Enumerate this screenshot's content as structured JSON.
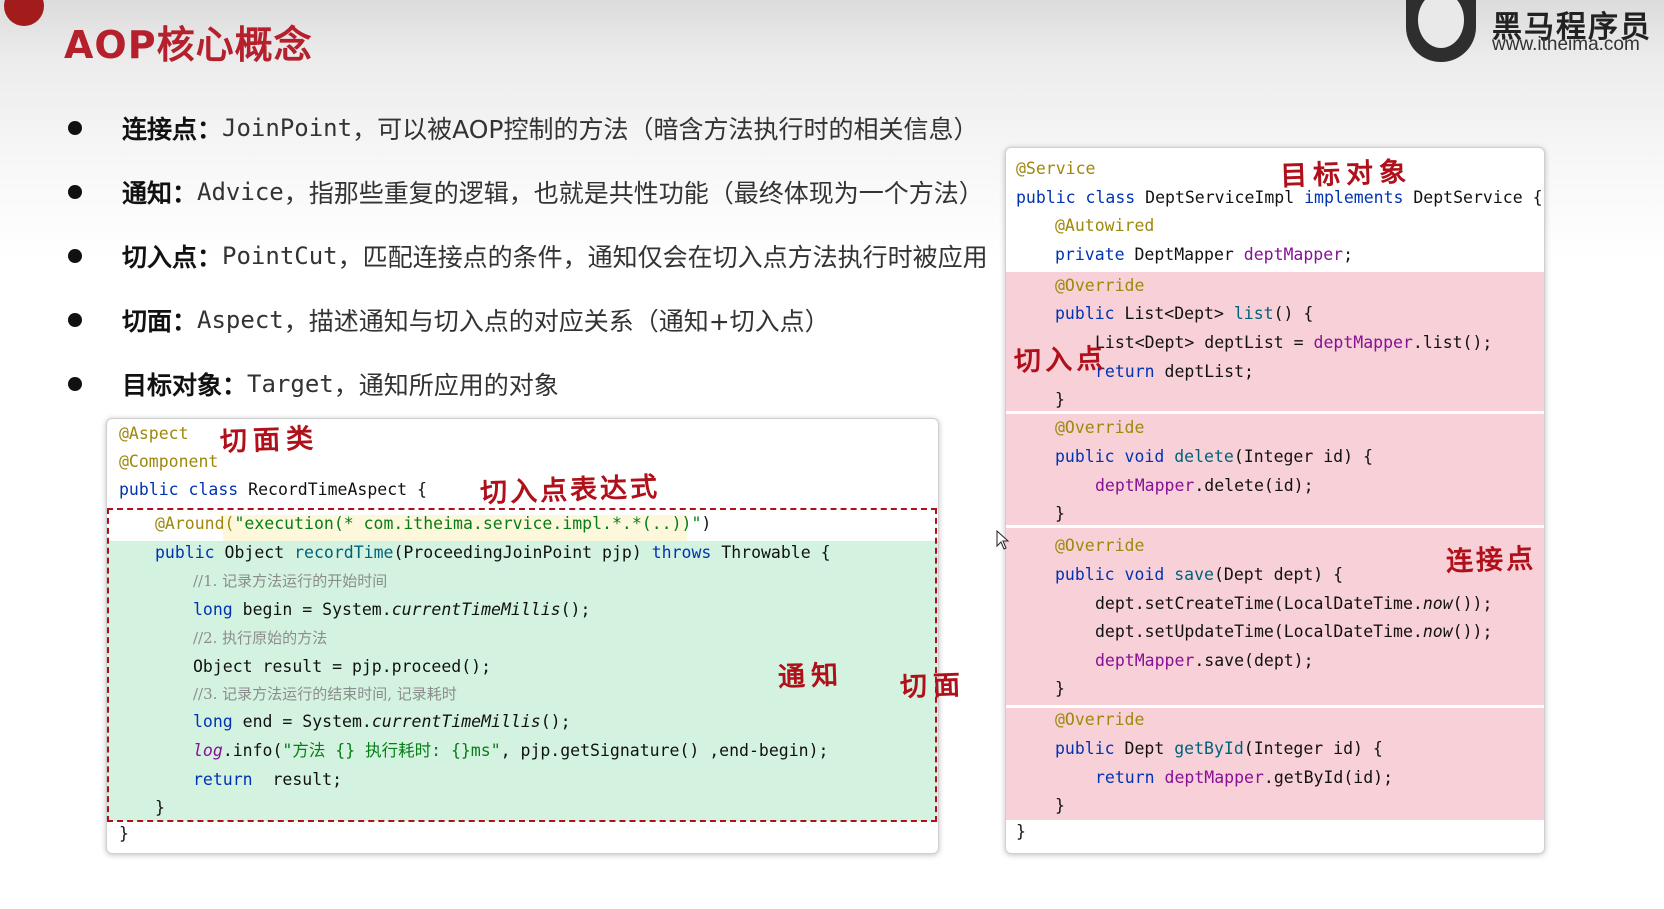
{
  "title": "AOP核心概念",
  "logo": {
    "name": "黑马程序员",
    "url": "www.itheima.com"
  },
  "bullets": [
    {
      "term": "连接点：",
      "en": "JoinPoint",
      "desc": "，可以被AOP控制的方法（暗含方法执行时的相关信息）"
    },
    {
      "term": "通知：",
      "en": "Advice",
      "desc": "，指那些重复的逻辑，也就是共性功能（最终体现为一个方法）"
    },
    {
      "term": "切入点：",
      "en": "PointCut",
      "desc": "，匹配连接点的条件，通知仅会在切入点方法执行时被应用"
    },
    {
      "term": "切面：",
      "en": "Aspect",
      "desc": "，描述通知与切入点的对应关系（通知+切入点）"
    },
    {
      "term": "目标对象：",
      "en": "Target",
      "desc": "，通知所应用的对象"
    }
  ],
  "left_code": {
    "l1": "@Aspect",
    "l2": "@Component",
    "l3_kw": "public class ",
    "l3_rest": "RecordTimeAspect {",
    "l4_ann": "@Around(",
    "l4_str": "\"execution(* com.itheima.service.impl.*.*(..))\"",
    "l4_end": ")",
    "l5_kw": "public ",
    "l5_type": "Object ",
    "l5_fn": "recordTime",
    "l5_args": "(ProceedingJoinPoint pjp) ",
    "l5_kw2": "throws ",
    "l5_end": "Throwable {",
    "l6": "//1. 记录方法运行的开始时间",
    "l7_kw": "long ",
    "l7_a": "begin = System.",
    "l7_it": "currentTimeMillis",
    "l7_b": "();",
    "l8": "//2. 执行原始的方法",
    "l9": "Object result = pjp.proceed();",
    "l10": "//3. 记录方法运行的结束时间, 记录耗时",
    "l11_kw": "long ",
    "l11_a": "end = System.",
    "l11_it": "currentTimeMillis",
    "l11_b": "();",
    "l12_it": "log",
    "l12_a": ".info(",
    "l12_str": "\"方法 {} 执行耗时: {}ms\"",
    "l12_b": ", pjp.getSignature() ,end-begin);",
    "l13_kw": "return ",
    "l13_a": " result;",
    "l14": "}",
    "l15": "}"
  },
  "right_code": {
    "r1": "@Service",
    "r2_kw": "public class ",
    "r2_a": "DeptServiceImpl ",
    "r2_kw2": "implements ",
    "r2_b": "DeptService {",
    "r3": "@Autowired",
    "r4_kw": "private ",
    "r4_a": "DeptMapper ",
    "r4_f": "deptMapper",
    "r4_b": ";",
    "r5": "@Override",
    "r6_kw": "public ",
    "r6_a": "List<Dept> ",
    "r6_fn": "list",
    "r6_b": "() {",
    "r7_a": "List<Dept> deptList = ",
    "r7_f": "deptMapper",
    "r7_b": ".list();",
    "r8_kw": "return ",
    "r8_a": "deptList;",
    "r9": "}",
    "r10": "@Override",
    "r11_kw": "public void ",
    "r11_fn": "delete",
    "r11_b": "(Integer id) {",
    "r12_f": "deptMapper",
    "r12_b": ".delete(id);",
    "r13": "}",
    "r14": "@Override",
    "r15_kw": "public void ",
    "r15_fn": "save",
    "r15_b": "(Dept dept) {",
    "r16_a": "dept.setCreateTime(LocalDateTime.",
    "r16_it": "now",
    "r16_b": "());",
    "r17_a": "dept.setUpdateTime(LocalDateTime.",
    "r17_it": "now",
    "r17_b": "());",
    "r18_f": "deptMapper",
    "r18_b": ".save(dept);",
    "r19": "}",
    "r20": "@Override",
    "r21_kw": "public ",
    "r21_a": "Dept ",
    "r21_fn": "getById",
    "r21_b": "(Integer id) {",
    "r22_kw": "return ",
    "r22_f": "deptMapper",
    "r22_b": ".getById(id);",
    "r23": "}",
    "r24": "}"
  },
  "handwriting": {
    "aspect_class": "切面类",
    "pointcut_expr": "切入点表达式",
    "advice": "通知",
    "aspect": "切面",
    "target": "目标对象",
    "pointcut": "切入点",
    "joinpoint": "连接点"
  },
  "colors": {
    "title": "#b5202c",
    "handwriting": "#b0101a",
    "advice_highlight": "#d3f3e0",
    "joinpoint_highlight": "#f8d0d7"
  }
}
